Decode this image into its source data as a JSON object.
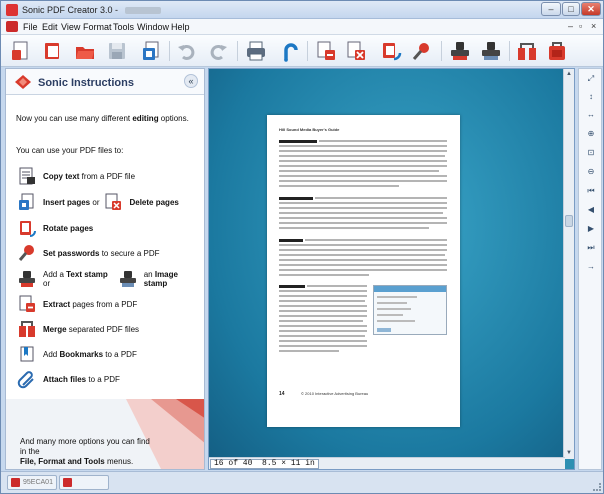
{
  "window": {
    "title": "Sonic PDF Creator 3.0 - ",
    "controls": {
      "minimize": "–",
      "maximize": "□",
      "close": "✕"
    },
    "mdi_controls": {
      "minimize": "–",
      "restore": "▫",
      "close": "×"
    }
  },
  "menu": {
    "items": [
      "File",
      "Edit",
      "View",
      "Format",
      "Tools",
      "Window",
      "Help"
    ]
  },
  "toolbar": {
    "icons": [
      "new-document-icon",
      "open-document-icon",
      "open-folder-icon",
      "save-icon",
      "insert-pages-icon",
      "undo-icon",
      "redo-icon",
      "print-icon",
      "bookmark-hook-icon",
      "extract-pages-icon",
      "delete-pages-icon",
      "rotate-icon",
      "password-icon",
      "text-stamp-icon",
      "image-stamp-icon",
      "merge-icon",
      "attach-icon"
    ]
  },
  "sidebar": {
    "title": "Sonic Instructions",
    "collapse_label": "«",
    "intro_text_1": "Now you can use many different ",
    "intro_bold": "editing",
    "intro_text_2": " options.",
    "use_text": "You can use your PDF files to:",
    "features": [
      {
        "icon": "copy-text-icon",
        "bold": "Copy text",
        "text": " from a PDF file"
      },
      {
        "icon": "insert-pages-icon",
        "bold": "Insert pages",
        "text": " or "
      },
      {
        "icon": "rotate-pages-icon",
        "bold": "Rotate pages",
        "text": ""
      },
      {
        "icon": "password-icon",
        "bold": "Set passwords",
        "text": " to secure a PDF"
      },
      {
        "icon": "text-stamp-icon",
        "bold": "",
        "text": "Add a "
      },
      {
        "icon": "extract-pages-icon",
        "bold": "Extract",
        "text": " pages from a PDF"
      },
      {
        "icon": "merge-files-icon",
        "bold": "Merge",
        "text": " separated PDF files"
      },
      {
        "icon": "bookmarks-icon",
        "bold": "",
        "text": "Add "
      },
      {
        "icon": "attach-files-icon",
        "bold": "Attach files",
        "text": " to a PDF"
      }
    ],
    "delete_pages_label": "Delete pages",
    "text_stamp_bold": "Text stamp",
    "text_stamp_or": " or ",
    "image_stamp_prefix": " an ",
    "image_stamp_bold": "Image stamp",
    "bookmarks_bold": "Bookmarks",
    "bookmarks_suffix": " to a PDF",
    "footer_line_1": "And many more options you can find in the",
    "footer_bold": "File, Format and Tools",
    "footer_suffix": " menus."
  },
  "viewer": {
    "page_indicator": "16 of 40",
    "page_size": "8.5 × 11 in",
    "page_content": {
      "header": "Hill Sound Media Buyer's Guide",
      "page_number": "14",
      "footer_text": "© 2010 Interactive Advertising Bureau",
      "sections": [
        "Virtual Worlds",
        "Virtual Goods",
        "Widgets",
        "Online Polls"
      ]
    }
  },
  "right_panel": {
    "buttons": [
      {
        "name": "zoom-fit-icon",
        "glyph": "⤢"
      },
      {
        "name": "fit-height-icon",
        "glyph": "↕"
      },
      {
        "name": "fit-width-icon",
        "glyph": "↔"
      },
      {
        "name": "zoom-in-icon",
        "glyph": "⊕"
      },
      {
        "name": "zoom-select-icon",
        "glyph": "⊡"
      },
      {
        "name": "zoom-out-icon",
        "glyph": "⊖"
      },
      {
        "name": "first-page-icon",
        "glyph": "⏮"
      },
      {
        "name": "prev-page-icon",
        "glyph": "◀"
      },
      {
        "name": "next-page-icon",
        "glyph": "▶"
      },
      {
        "name": "last-page-icon",
        "glyph": "⏭"
      },
      {
        "name": "go-to-page-icon",
        "glyph": "→"
      }
    ]
  },
  "statusbar": {
    "tabs": [
      {
        "label": "95ECA01"
      },
      {
        "label": ""
      }
    ]
  }
}
